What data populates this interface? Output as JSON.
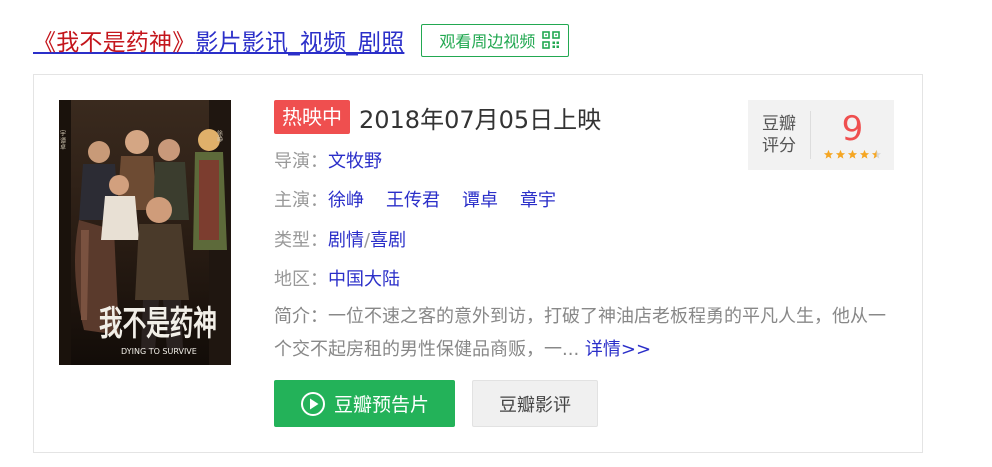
{
  "header": {
    "title_red": "《我不是药神》",
    "title_rest": "影片影讯_视频_剧照",
    "nearby_btn": "观看周边视频"
  },
  "movie": {
    "status_badge": "热映中",
    "release": "2018年07月05日上映",
    "director_label": "导演：",
    "director": "文牧野",
    "actors_label": "主演：",
    "actors": [
      "徐峥",
      "王传君",
      "谭卓",
      "章宇"
    ],
    "genre_label": "类型：",
    "genre_1": "剧情",
    "genre_sep": "/",
    "genre_2": "喜剧",
    "region_label": "地区：",
    "region": "中国大陆",
    "synopsis_label": "简介：",
    "synopsis": "一位不速之客的意外到访，打破了神油店老板程勇的平凡人生，他从一个交不起房租的男性保健品商贩，一...",
    "more_link": "详情>>",
    "poster_title": "我不是药神",
    "poster_subtitle": "DYING TO SURVIVE"
  },
  "rating": {
    "label_1": "豆瓣",
    "label_2": "评分",
    "score": "9",
    "stars": 4.5
  },
  "buttons": {
    "trailer": "豆瓣预告片",
    "review": "豆瓣影评"
  },
  "colors": {
    "link": "#2b2fc9",
    "title_red": "#c4161c",
    "green": "#23b259",
    "badge_red": "#ef4f4f",
    "star": "#f5a623"
  }
}
